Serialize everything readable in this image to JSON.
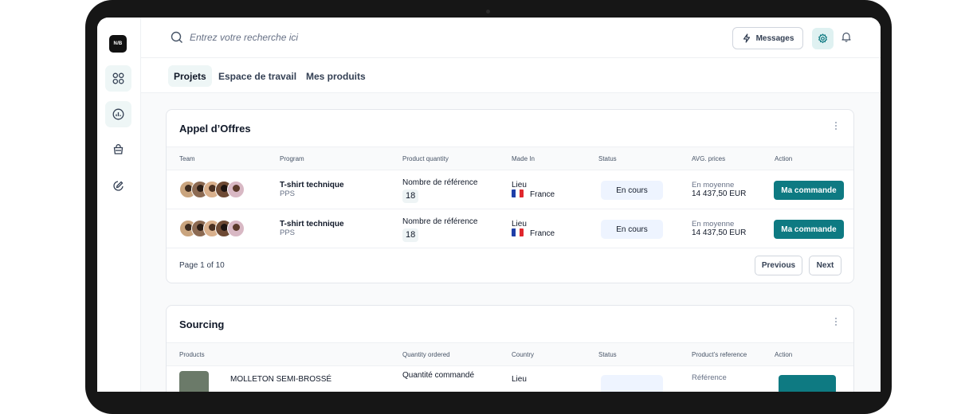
{
  "sidebar": {
    "logo_text": "N/B",
    "items": [
      {
        "icon": "grid-icon",
        "active": true
      },
      {
        "icon": "chart-icon",
        "active": true
      },
      {
        "icon": "bag-icon",
        "active": false
      },
      {
        "icon": "edit-icon",
        "active": false
      }
    ]
  },
  "header": {
    "search_placeholder": "Entrez votre recherche ici",
    "messages_label": "Messages"
  },
  "tabs": [
    {
      "label": "Projets",
      "active": true
    },
    {
      "label": "Espace de travail",
      "active": false
    },
    {
      "label": "Mes produits",
      "active": false
    }
  ],
  "offers": {
    "title": "Appel d’Offres",
    "columns": [
      "Team",
      "Program",
      "Product quantity",
      "Made In",
      "Status",
      "AVG. prices",
      "Action"
    ],
    "rows": [
      {
        "program": "T-shirt technique",
        "program_sub": "PPS",
        "qty_label": "Nombre de référence",
        "qty": "18",
        "lieu": "Lieu",
        "country": "France",
        "status": "En cours",
        "avg_label": "En moyenne",
        "avg": "14 437,50 EUR",
        "action": "Ma commande"
      },
      {
        "program": "T-shirt technique",
        "program_sub": "PPS",
        "qty_label": "Nombre de référence",
        "qty": "18",
        "lieu": "Lieu",
        "country": "France",
        "status": "En cours",
        "avg_label": "En moyenne",
        "avg": "14 437,50 EUR",
        "action": "Ma commande"
      }
    ],
    "pagination": {
      "text": "Page 1 of 10",
      "previous": "Previous",
      "next": "Next"
    }
  },
  "sourcing": {
    "title": "Sourcing",
    "columns": [
      "Products",
      "Quantity ordered",
      "Country",
      "Status",
      "Product’s reference",
      "Action"
    ],
    "rows": [
      {
        "product": "MOLLETON SEMI-BROSSÉ",
        "qty_label": "Quantité commandé",
        "lieu": "Lieu",
        "ref_label": "Référence"
      }
    ]
  },
  "colors": {
    "accent": "#0e7a82",
    "accent_light": "#dff1f1",
    "status_bg": "#eef4ff"
  }
}
